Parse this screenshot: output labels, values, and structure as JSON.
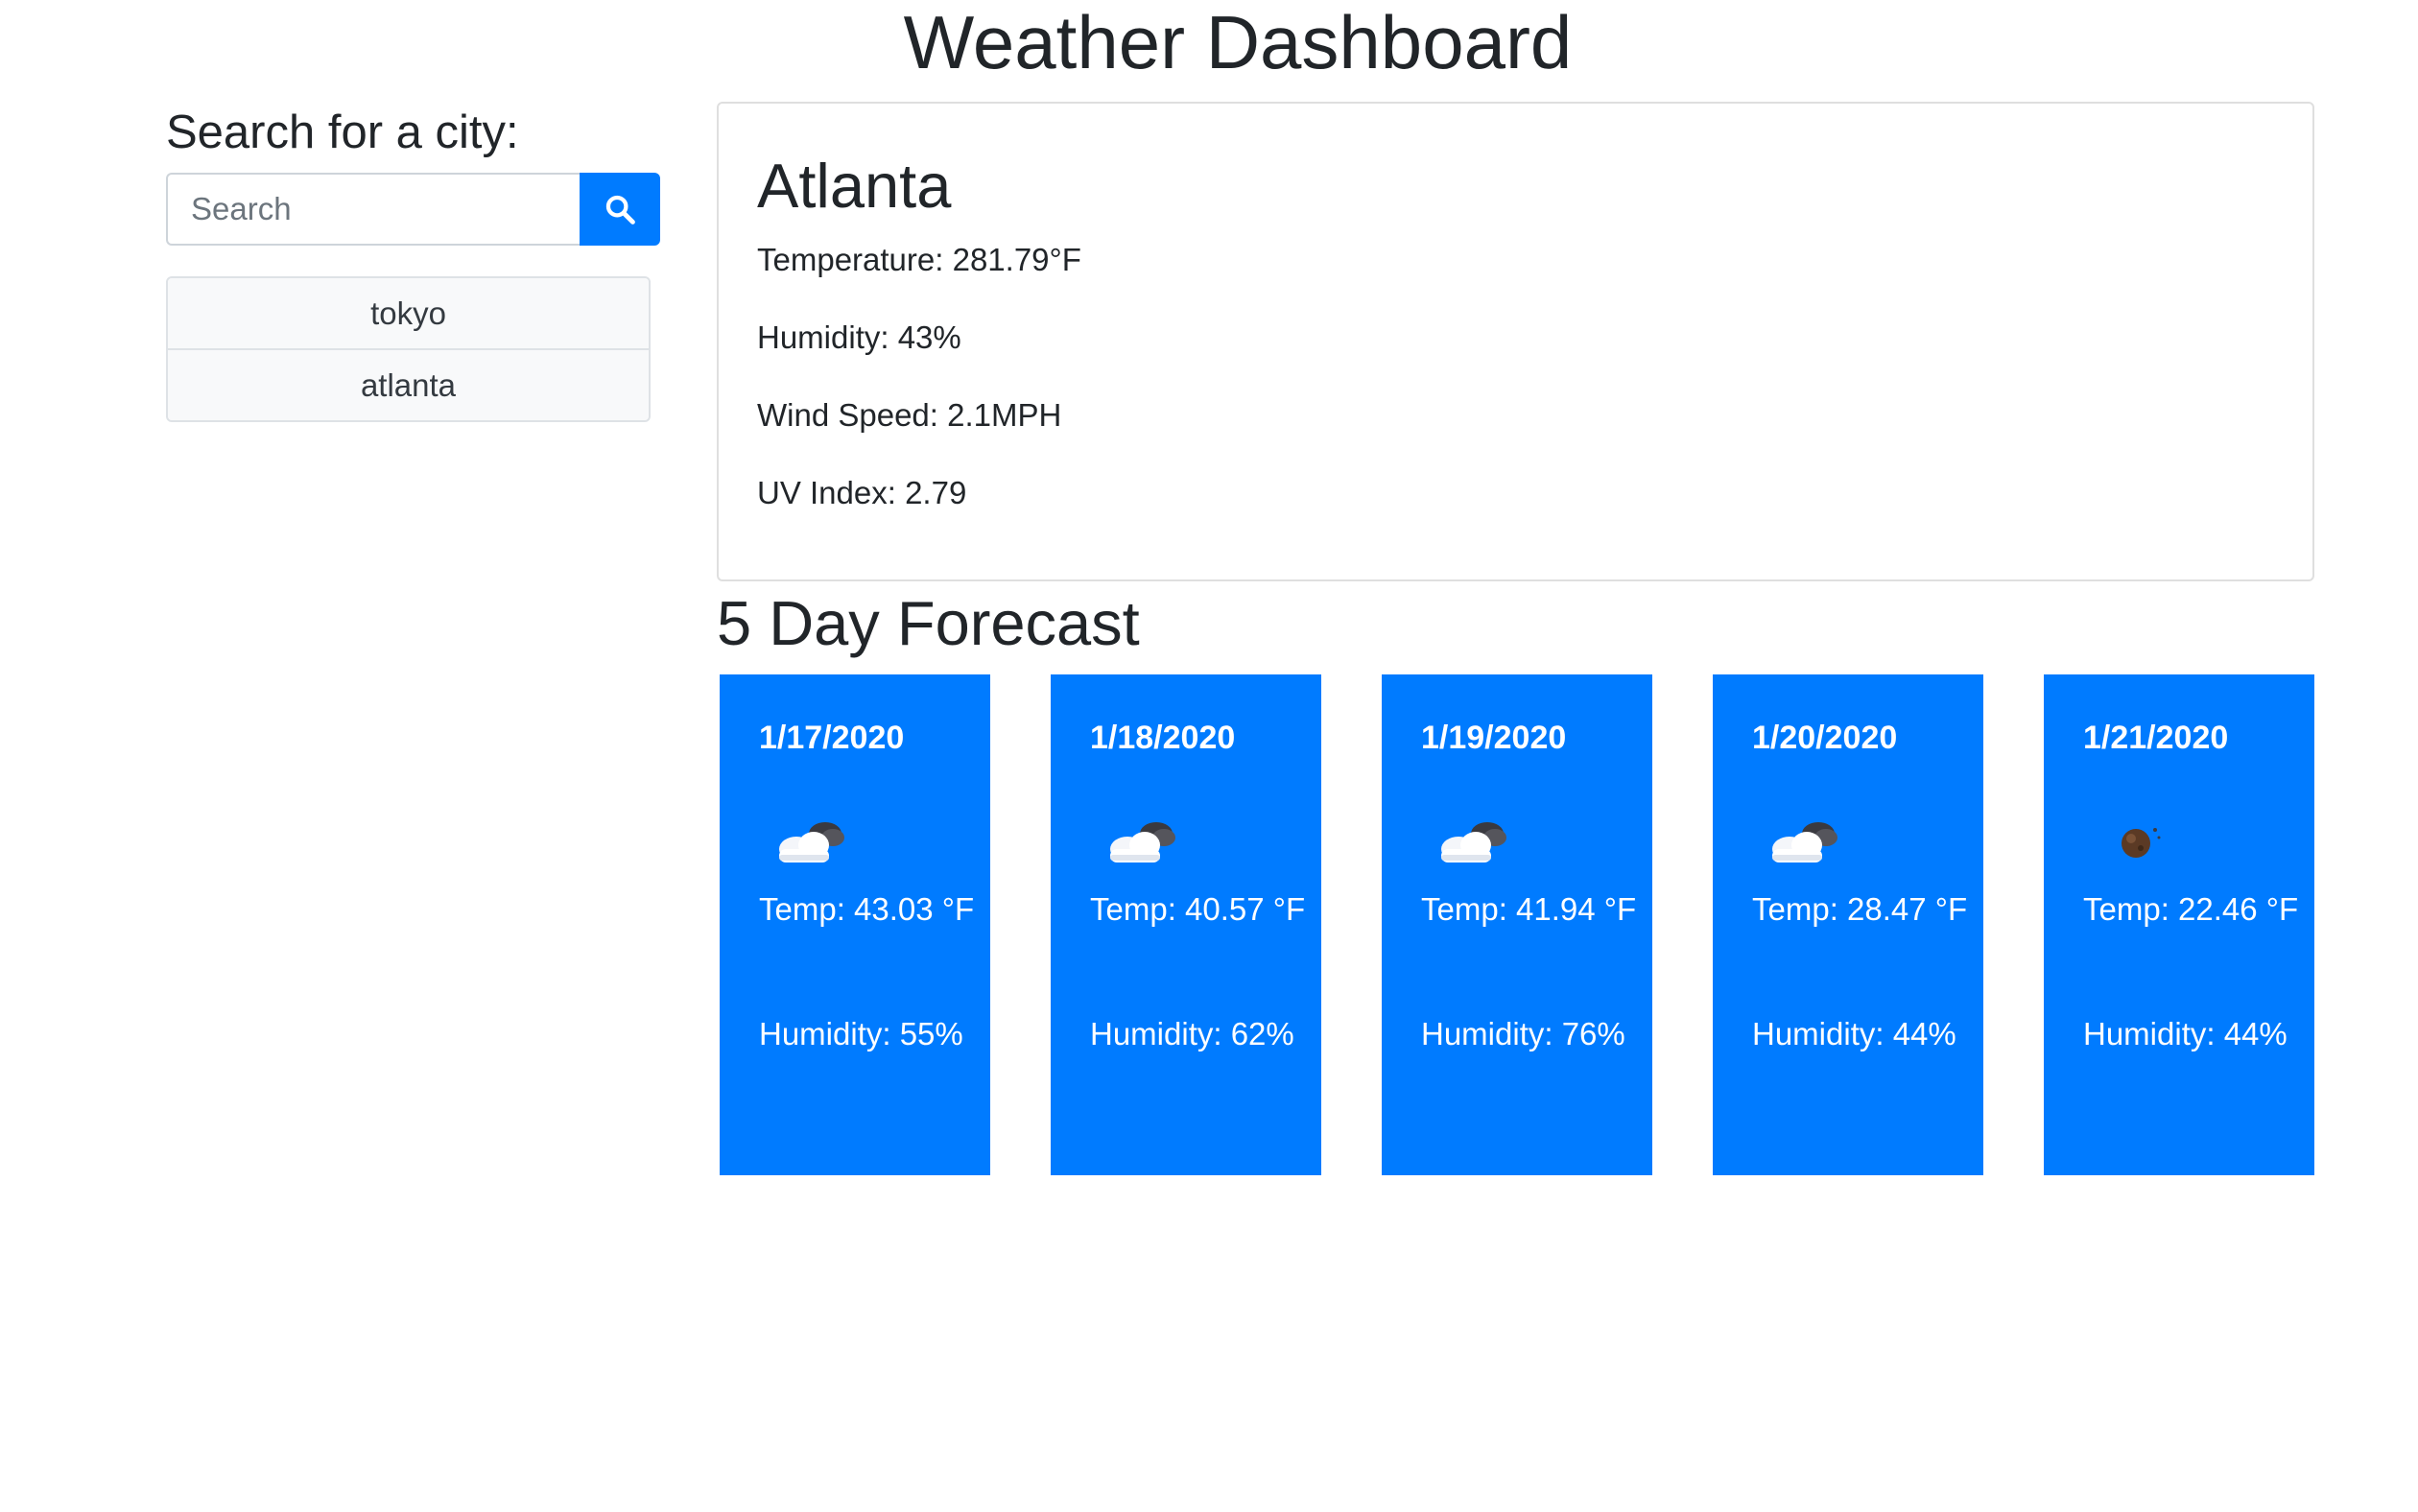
{
  "page": {
    "title": "Weather Dashboard"
  },
  "sidebar": {
    "heading": "Search for a city:",
    "search": {
      "placeholder": "Search",
      "value": "",
      "button_icon": "search-icon"
    },
    "history": [
      {
        "label": "tokyo"
      },
      {
        "label": "atlanta"
      }
    ]
  },
  "current": {
    "city": "Atlanta",
    "temperature": "Temperature: 281.79°F",
    "humidity": "Humidity: 43%",
    "wind_speed": "Wind Speed: 2.1MPH",
    "uv_index": "UV Index: 2.79"
  },
  "forecast": {
    "heading": "5 Day Forecast",
    "days": [
      {
        "date": "1/17/2020",
        "icon": "cloud-night-icon",
        "temp": "Temp: 43.03 °F",
        "humidity": "Humidity: 55%"
      },
      {
        "date": "1/18/2020",
        "icon": "cloud-night-icon",
        "temp": "Temp: 40.57 °F",
        "humidity": "Humidity: 62%"
      },
      {
        "date": "1/19/2020",
        "icon": "cloud-night-icon",
        "temp": "Temp: 41.94 °F",
        "humidity": "Humidity: 76%"
      },
      {
        "date": "1/20/2020",
        "icon": "cloud-night-icon",
        "temp": "Temp: 28.47 °F",
        "humidity": "Humidity: 44%"
      },
      {
        "date": "1/21/2020",
        "icon": "night-clear-icon",
        "temp": "Temp: 22.46 °F",
        "humidity": "Humidity: 44%"
      }
    ]
  },
  "colors": {
    "primary": "#007bff",
    "card_text": "#ffffff",
    "text": "#212529",
    "border": "#dee2e6",
    "list_bg": "#f8f9fa"
  }
}
